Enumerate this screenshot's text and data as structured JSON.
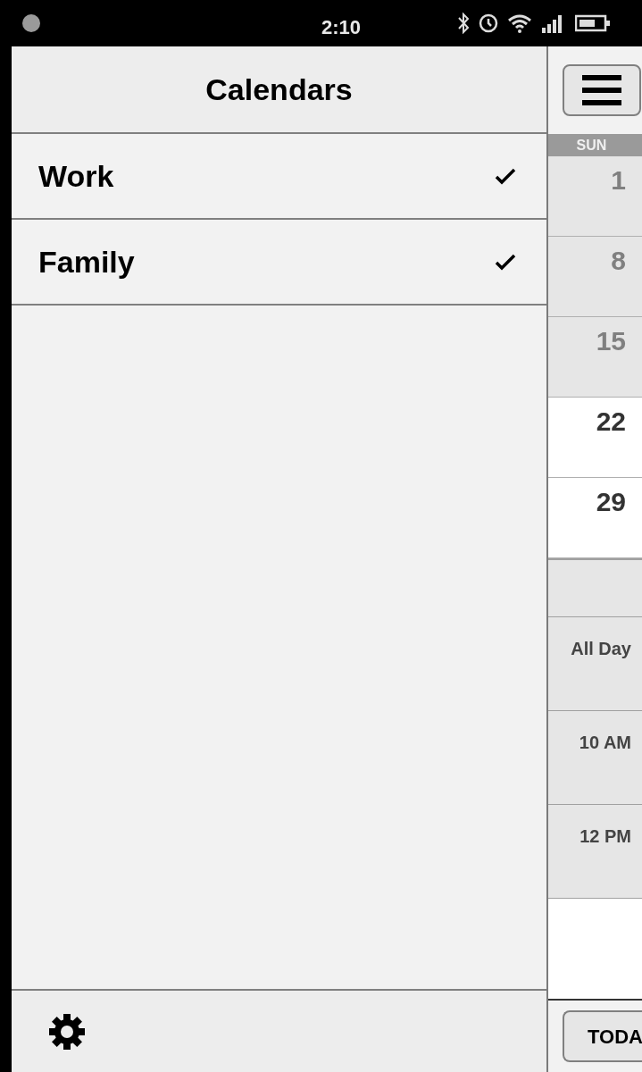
{
  "status_bar": {
    "time": "2:10"
  },
  "sidebar": {
    "title": "Calendars",
    "calendars": [
      {
        "name": "Work",
        "checked": true
      },
      {
        "name": "Family",
        "checked": true
      }
    ]
  },
  "calendar": {
    "day_header": "SUN",
    "days": [
      {
        "label": "1",
        "dimmed": true
      },
      {
        "label": "8",
        "dimmed": true
      },
      {
        "label": "15",
        "dimmed": true
      },
      {
        "label": "22",
        "dimmed": false
      },
      {
        "label": "29",
        "dimmed": false
      }
    ],
    "time_slots": [
      "All Day",
      "10 AM",
      "12 PM"
    ],
    "today_button": "TODA"
  }
}
